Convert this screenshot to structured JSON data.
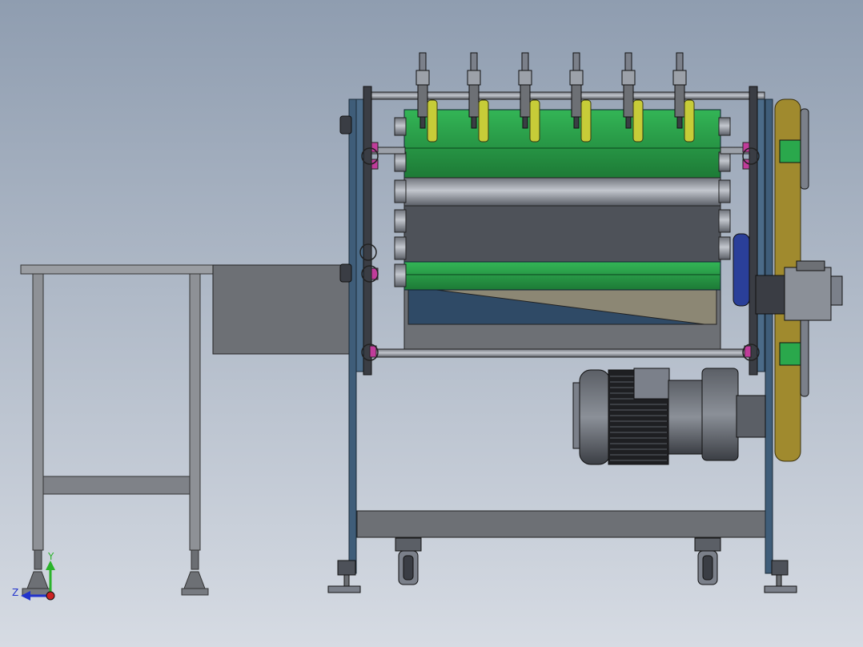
{
  "viewport": {
    "background_top": "#8f9db0",
    "background_bottom": "#d6dbe3"
  },
  "colors": {
    "frame_blue": "#3f5d79",
    "steel_dark": "#4d5159",
    "steel_mid": "#7b808a",
    "steel_light": "#a9aeb6",
    "belt_green": "#2aa84c",
    "belt_green_dark": "#1f7f3a",
    "belt_panel_gray": "#5b5f66",
    "wedge_blue": "#2f4a66",
    "wedge_tan": "#8c8774",
    "blade_yellow": "#c7cc38",
    "drive_belt_gold": "#a08a2e",
    "bearing_magenta": "#c03c9a",
    "motor_black": "#1e1f22",
    "table_gray": "#8e9196",
    "hopper_gray": "#6d7075"
  },
  "coordinate_triad": {
    "y_label": "Y",
    "z_label": "Z",
    "y_color": "#2bb32b",
    "z_color": "#2233cc",
    "origin_color": "#cc2222"
  }
}
